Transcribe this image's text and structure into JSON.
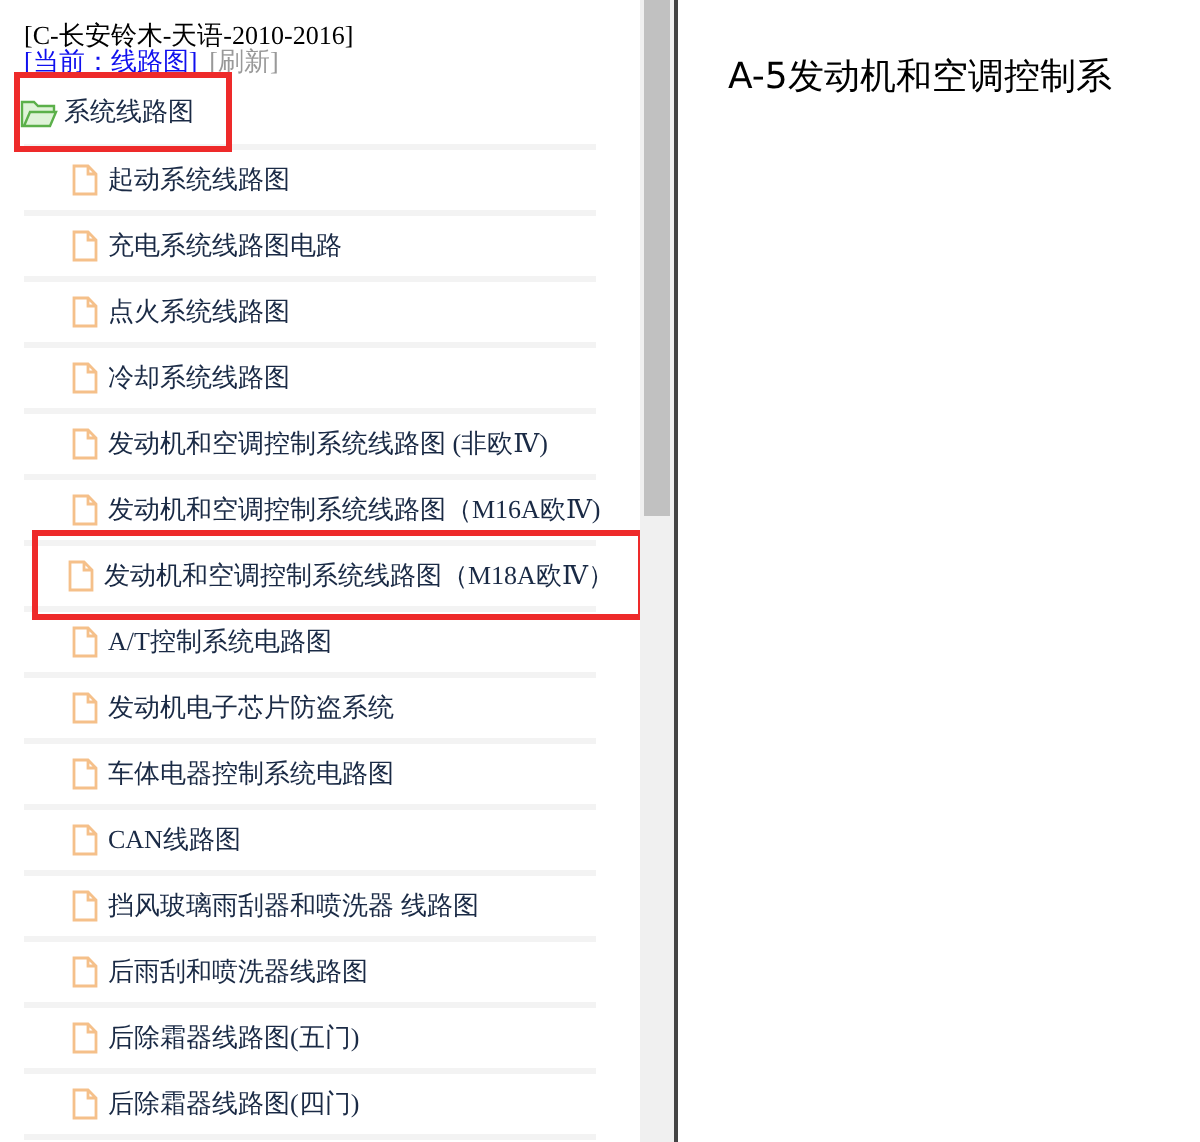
{
  "header": {
    "title": "[C-长安铃木-天语-2010-2016]",
    "current": "[当前：线路图]",
    "refresh": "[刷新]"
  },
  "tree": {
    "label": "系统线路图",
    "expanded": true,
    "highlighted": true,
    "children": [
      {
        "label": "起动系统线路图",
        "highlighted": false
      },
      {
        "label": "充电系统线路图电路",
        "highlighted": false
      },
      {
        "label": "点火系统线路图",
        "highlighted": false
      },
      {
        "label": "冷却系统线路图",
        "highlighted": false
      },
      {
        "label": "发动机和空调控制系统线路图 (非欧Ⅳ)",
        "highlighted": false
      },
      {
        "label": "发动机和空调控制系统线路图（M16A欧Ⅳ)",
        "highlighted": false
      },
      {
        "label": "发动机和空调控制系统线路图（M18A欧Ⅳ）",
        "highlighted": true
      },
      {
        "label": "A/T控制系统电路图",
        "highlighted": false
      },
      {
        "label": "发动机电子芯片防盗系统",
        "highlighted": false
      },
      {
        "label": "车体电器控制系统电路图",
        "highlighted": false
      },
      {
        "label": "CAN线路图",
        "highlighted": false
      },
      {
        "label": "挡风玻璃雨刮器和喷洗器 线路图",
        "highlighted": false
      },
      {
        "label": "后雨刮和喷洗器线路图",
        "highlighted": false
      },
      {
        "label": "后除霜器线路图(五门)",
        "highlighted": false
      },
      {
        "label": "后除霜器线路图(四门)",
        "highlighted": false
      }
    ]
  },
  "content": {
    "title": "A-5发动机和空调控制系"
  }
}
